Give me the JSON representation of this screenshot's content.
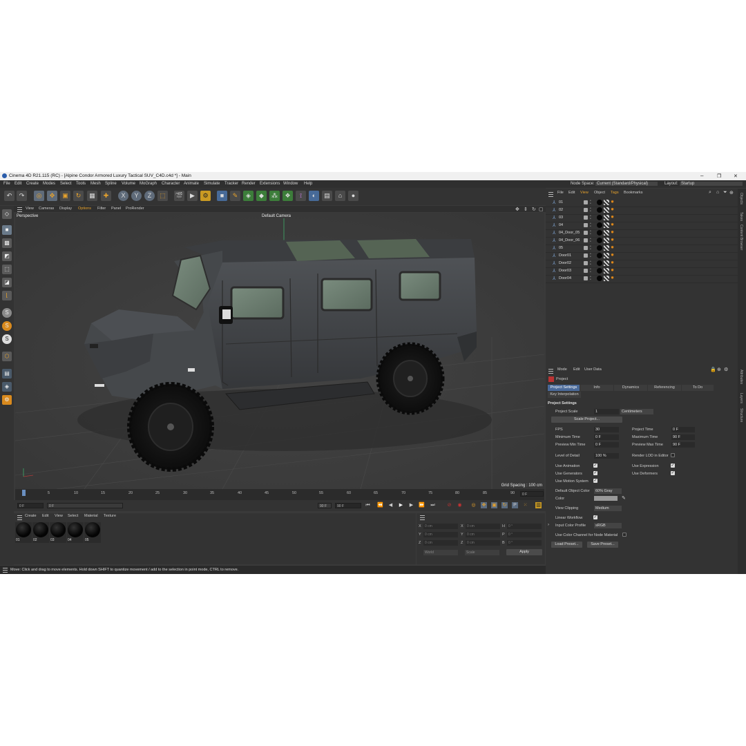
{
  "window": {
    "title": "Cinema 4D R21.115 (RC) - [Alpine Condor Armored Luxury Tactical SUV_C4D.c4d *] - Main",
    "minimize": "–",
    "maximize": "❐",
    "close": "✕"
  },
  "menu": {
    "items": [
      "File",
      "Edit",
      "Create",
      "Modes",
      "Select",
      "Tools",
      "Mesh",
      "Spline",
      "Volume",
      "MoGraph",
      "Character",
      "Animate",
      "Simulate",
      "Tracker",
      "Render",
      "Extensions",
      "Window",
      "Help"
    ],
    "node_space_label": "Node Space:",
    "node_space_value": "Current (Standard/Physical)",
    "layout_label": "Layout:",
    "layout_value": "Startup"
  },
  "toolbar": {
    "x_label": "X",
    "y_label": "Y",
    "z_label": "Z"
  },
  "left_tools": {
    "s1": "S",
    "s2": "S",
    "s3": "S"
  },
  "viewport": {
    "menu": [
      "View",
      "Cameras",
      "Display",
      "Options",
      "Filter",
      "Panel",
      "ProRender"
    ],
    "label": "Perspective",
    "camera": "Default Camera",
    "grid_spacing": "Grid Spacing : 100 cm"
  },
  "timeline": {
    "ticks": [
      "0",
      "5",
      "10",
      "15",
      "20",
      "25",
      "30",
      "35",
      "40",
      "45",
      "50",
      "55",
      "60",
      "65",
      "70",
      "75",
      "80",
      "85",
      "90"
    ],
    "current_frame_field": "0 F",
    "start_field": "0 F",
    "range_start": "0 F",
    "range_end": "90 F",
    "end_field": "90 F"
  },
  "material_manager": {
    "menu": [
      "Create",
      "Edit",
      "View",
      "Select",
      "Material",
      "Texture"
    ],
    "materials": [
      "01",
      "02",
      "03",
      "04",
      "05"
    ]
  },
  "coordinates": {
    "rows": [
      {
        "a": "X",
        "av": "0 cm",
        "b": "X",
        "bv": "0 cm",
        "c": "H",
        "cv": "0 °"
      },
      {
        "a": "Y",
        "av": "0 cm",
        "b": "Y",
        "bv": "0 cm",
        "c": "P",
        "cv": "0 °"
      },
      {
        "a": "Z",
        "av": "0 cm",
        "b": "Z",
        "bv": "0 cm",
        "c": "B",
        "cv": "0 °"
      }
    ],
    "space": "World",
    "mode": "Scale",
    "apply": "Apply"
  },
  "status": {
    "text": "Move: Click and drag to move elements. Hold down SHIFT to quantize movement / add to the selection in point mode, CTRL to remove."
  },
  "object_manager": {
    "menu": [
      "File",
      "Edit",
      "View",
      "Object",
      "Tags",
      "Bookmarks"
    ],
    "objects": [
      "01",
      "02",
      "03",
      "04",
      "04_Door_05",
      "04_Door_06",
      "05",
      "Door01",
      "Door02",
      "Door03",
      "Door04"
    ]
  },
  "right_tabs": {
    "top": [
      "Objects",
      "Takes",
      "Content Browser"
    ],
    "bottom": [
      "Attributes",
      "Layers",
      "Structure"
    ]
  },
  "attributes": {
    "menu": [
      "Mode",
      "Edit",
      "User Data"
    ],
    "object_name": "Project",
    "tabs": [
      "Project Settings",
      "Info",
      "Dynamics",
      "Referencing",
      "To Do"
    ],
    "subtab": "Key Interpolation",
    "section": "Project Settings",
    "project_scale_label": "Project Scale",
    "project_scale_value": "1",
    "project_scale_unit": "Centimeters",
    "scale_project_button": "Scale Project...",
    "fps_label": "FPS",
    "fps_value": "30",
    "project_time_label": "Project Time",
    "project_time_value": "0 F",
    "min_time_label": "Minimum Time",
    "min_time_value": "0 F",
    "max_time_label": "Maximum Time",
    "max_time_value": "90 F",
    "preview_min_label": "Preview Min Time",
    "preview_min_value": "0 F",
    "preview_max_label": "Preview Max Time",
    "preview_max_value": "90 F",
    "lod_label": "Level of Detail",
    "lod_value": "100 %",
    "render_lod_label": "Render LOD in Editor",
    "use_animation": "Use Animation",
    "use_expression": "Use Expression",
    "use_generators": "Use Generators",
    "use_deformers": "Use Deformers",
    "use_motion": "Use Motion System",
    "default_color_label": "Default Object Color",
    "default_color_value": "60% Gray",
    "color_label": "Color",
    "view_clipping_label": "View Clipping",
    "view_clipping_value": "Medium",
    "linear_workflow": "Linear Workflow",
    "input_profile_label": "Input Color Profile",
    "input_profile_value": "sRGB",
    "color_channel_label": "Use Color Channel for Node Material",
    "load_preset": "Load Preset...",
    "save_preset": "Save Preset..."
  },
  "colors": {
    "ui_bg": "#3a3a3a",
    "accent_blue": "#4a6a9a",
    "accent_orange": "#d98a1e"
  }
}
